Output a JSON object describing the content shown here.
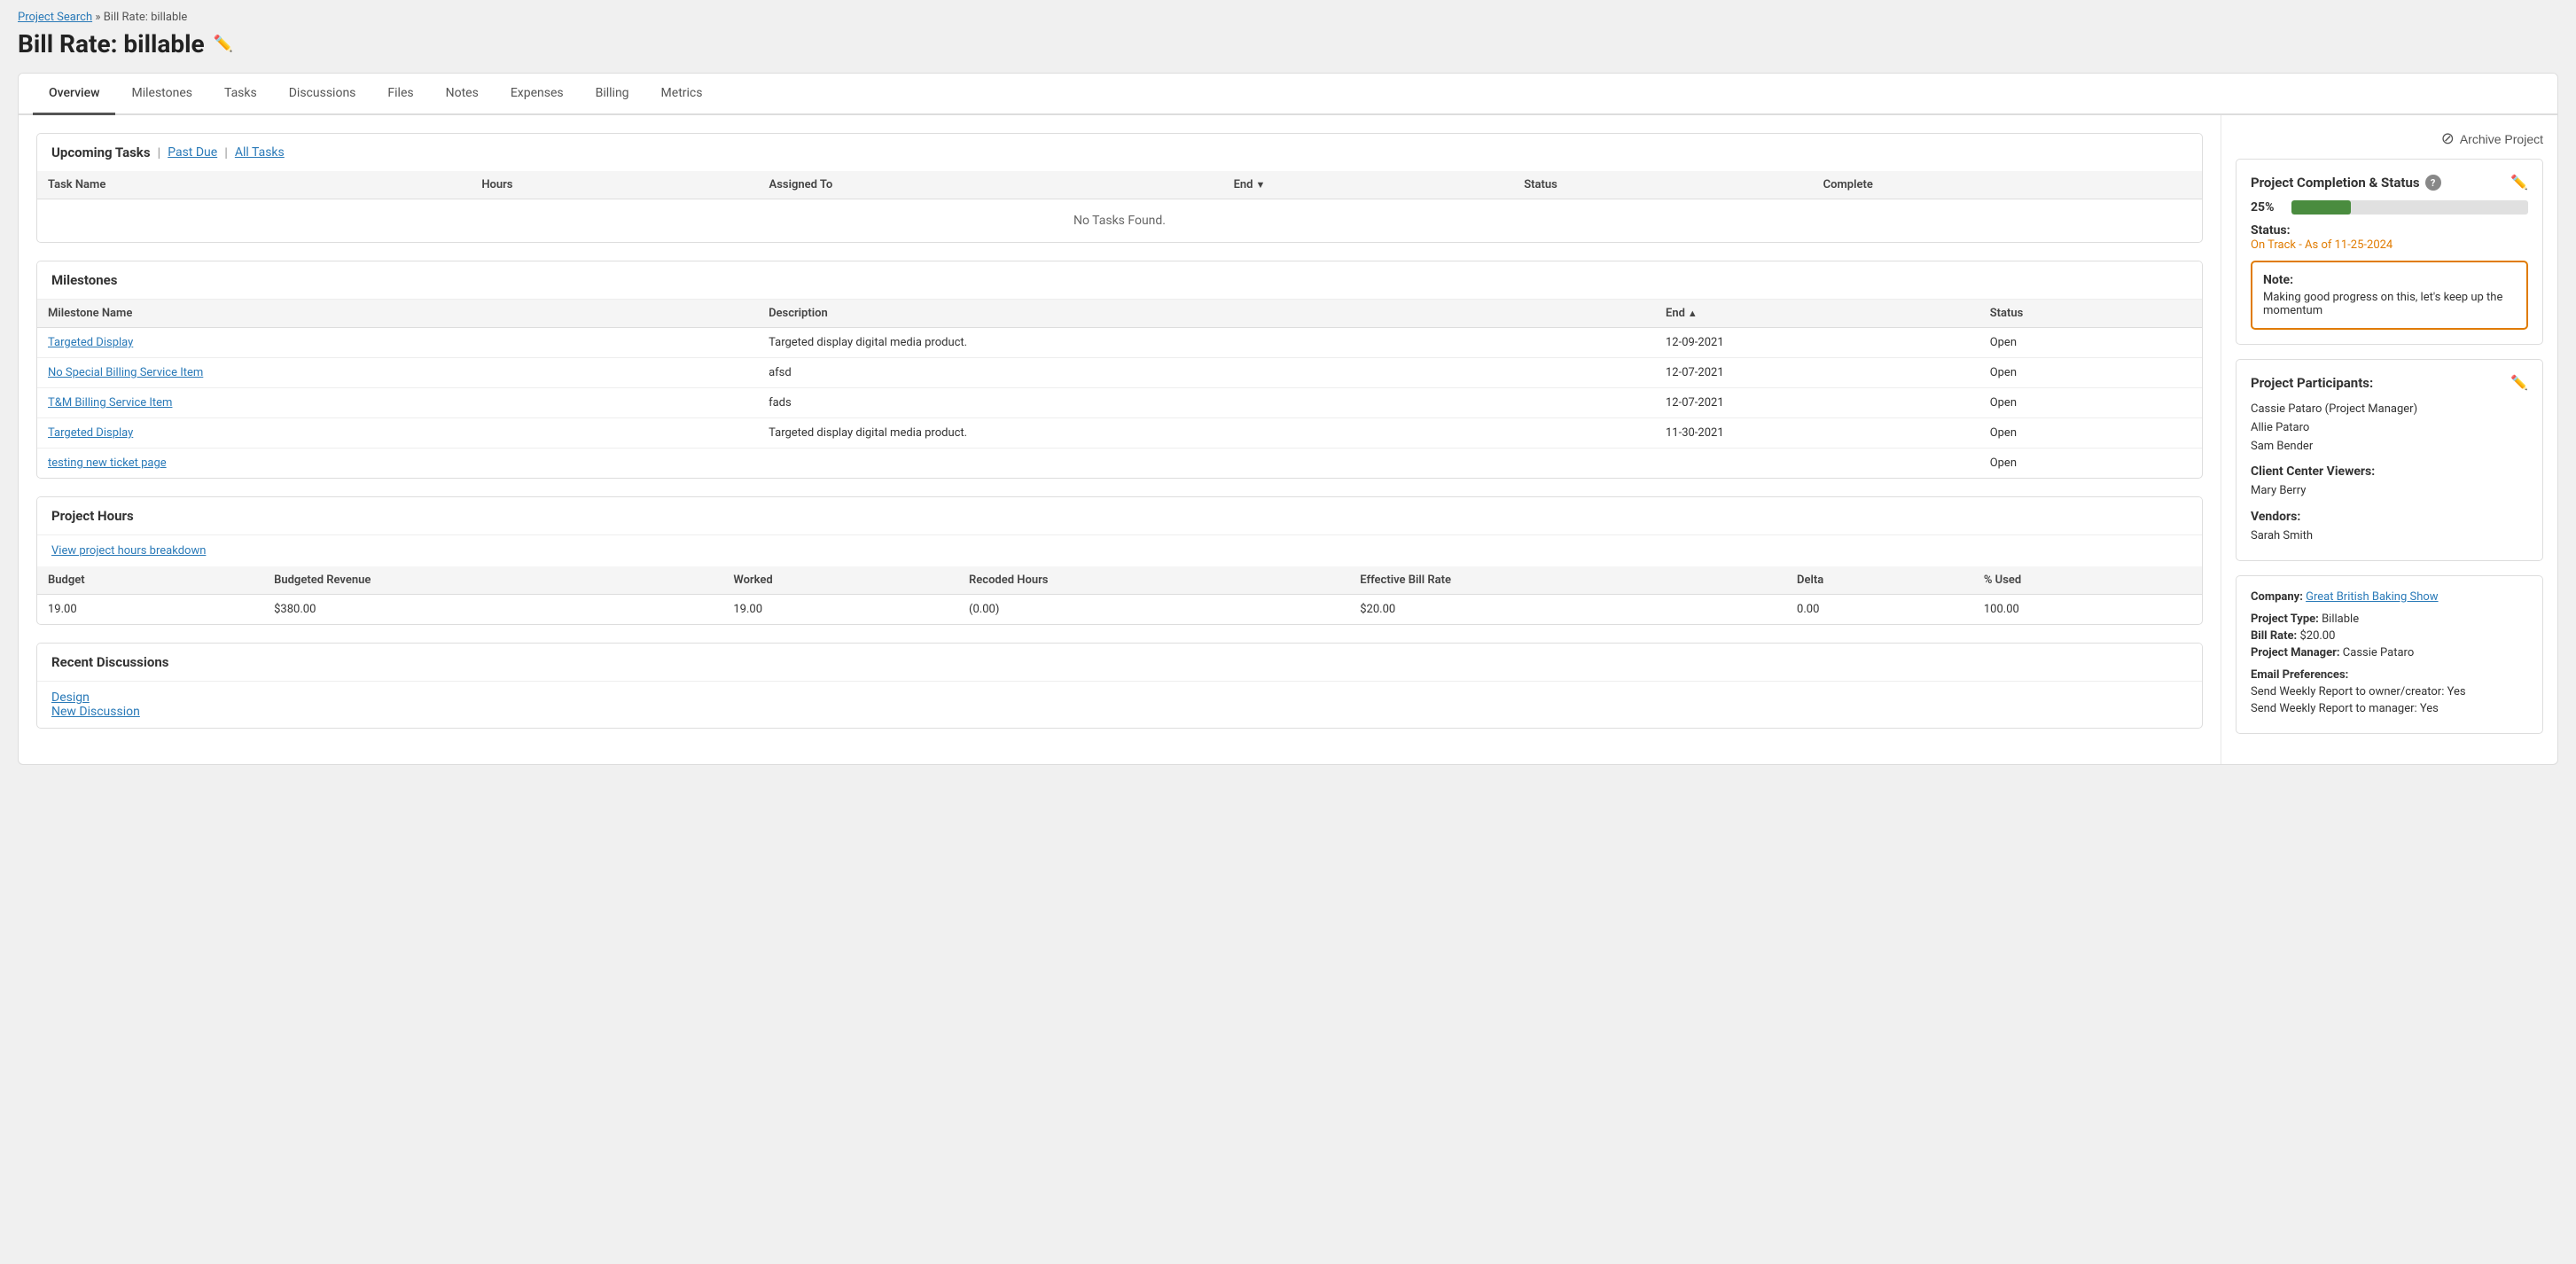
{
  "breadcrumb": {
    "link_text": "Project Search",
    "separator": "»",
    "current": "Bill Rate: billable"
  },
  "page_title": "Bill Rate: billable",
  "tabs": [
    {
      "label": "Overview",
      "active": true
    },
    {
      "label": "Milestones",
      "active": false
    },
    {
      "label": "Tasks",
      "active": false
    },
    {
      "label": "Discussions",
      "active": false
    },
    {
      "label": "Files",
      "active": false
    },
    {
      "label": "Notes",
      "active": false
    },
    {
      "label": "Expenses",
      "active": false
    },
    {
      "label": "Billing",
      "active": false
    },
    {
      "label": "Metrics",
      "active": false
    }
  ],
  "archive_button": "Archive Project",
  "upcoming_tasks": {
    "title": "Upcoming Tasks",
    "filter_past_due": "Past Due",
    "filter_all_tasks": "All Tasks",
    "columns": [
      "Task Name",
      "Hours",
      "Assigned To",
      "End",
      "Status",
      "Complete"
    ],
    "no_data_message": "No Tasks Found."
  },
  "milestones": {
    "title": "Milestones",
    "columns": [
      "Milestone Name",
      "Description",
      "End",
      "Status"
    ],
    "rows": [
      {
        "name": "Targeted Display",
        "description": "Targeted display digital media product.",
        "end": "12-09-2021",
        "status": "Open"
      },
      {
        "name": "No Special Billing Service Item",
        "description": "afsd",
        "end": "12-07-2021",
        "status": "Open"
      },
      {
        "name": "T&M Billing Service Item",
        "description": "fads",
        "end": "12-07-2021",
        "status": "Open"
      },
      {
        "name": "Targeted Display",
        "description": "Targeted display digital media product.",
        "end": "11-30-2021",
        "status": "Open"
      },
      {
        "name": "testing new ticket page",
        "description": "",
        "end": "",
        "status": "Open"
      }
    ]
  },
  "project_hours": {
    "title": "Project Hours",
    "view_breakdown_link": "View project hours breakdown",
    "columns": [
      "Budget",
      "Budgeted Revenue",
      "Worked",
      "Recoded Hours",
      "Effective Bill Rate",
      "Delta",
      "% Used"
    ],
    "rows": [
      {
        "budget": "19.00",
        "budgeted_revenue": "$380.00",
        "worked": "19.00",
        "recoded_hours": "(0.00)",
        "effective_bill_rate": "$20.00",
        "delta": "0.00",
        "pct_used": "100.00"
      }
    ]
  },
  "recent_discussions": {
    "title": "Recent Discussions",
    "links": [
      "Design",
      "New Discussion"
    ]
  },
  "right_panel": {
    "completion_status": {
      "title": "Project Completion & Status",
      "progress_pct": "25%",
      "progress_value": 25,
      "status_label": "Status:",
      "status_value": "On Track - As of 11-25-2024",
      "note_label": "Note:",
      "note_text": "Making good progress on this, let's keep up the momentum"
    },
    "participants": {
      "title": "Project Participants:",
      "manager": "Cassie Pataro (Project Manager)",
      "others": [
        "Allie Pataro",
        "Sam Bender"
      ],
      "client_center_label": "Client Center Viewers:",
      "client_center": [
        "Mary Berry"
      ],
      "vendors_label": "Vendors:",
      "vendors": [
        "Sarah Smith"
      ]
    },
    "project_info": {
      "company_label": "Company:",
      "company_name": "Great British Baking Show",
      "project_type_label": "Project Type:",
      "project_type": "Billable",
      "bill_rate_label": "Bill Rate:",
      "bill_rate": "$20.00",
      "project_manager_label": "Project Manager:",
      "project_manager": "Cassie Pataro",
      "email_prefs_label": "Email Preferences:",
      "email_pref1": "Send Weekly Report to owner/creator: Yes",
      "email_pref2": "Send Weekly Report to manager: Yes"
    }
  }
}
